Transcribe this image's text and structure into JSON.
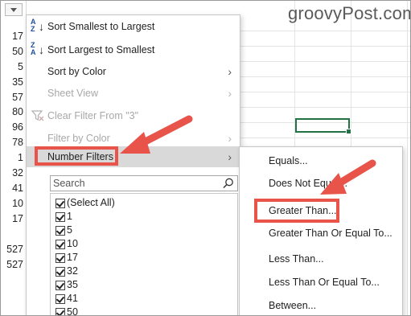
{
  "watermark": "groovyPost.com",
  "row_values": [
    "17",
    "50",
    "5",
    "35",
    "57",
    "80",
    "96",
    "78",
    "1",
    "32",
    "41",
    "10",
    "17",
    "527",
    "527"
  ],
  "menu": {
    "sort_asc": "Sort Smallest to Largest",
    "sort_desc": "Sort Largest to Smallest",
    "sort_by_color": "Sort by Color",
    "sheet_view": "Sheet View",
    "clear_filter": "Clear Filter From \"3\"",
    "filter_by_color": "Filter by Color",
    "number_filters": "Number Filters",
    "search_placeholder": "Search"
  },
  "filter_list": [
    "(Select All)",
    "1",
    "5",
    "10",
    "17",
    "32",
    "35",
    "41",
    "50"
  ],
  "submenu": {
    "equals": "Equals...",
    "does_not_equal": "Does Not Equal...",
    "greater_than": "Greater Than...",
    "greater_equal": "Greater Than Or Equal To...",
    "less_than": "Less Than...",
    "less_equal": "Less Than Or Equal To...",
    "between": "Between..."
  },
  "colors": {
    "highlight_red": "#e8544a",
    "active_cell_green": "#217346",
    "sort_icon_blue": "#1f4e9a"
  },
  "icons": {
    "sort_asc": "sort-ascending-icon",
    "sort_desc": "sort-descending-icon",
    "clear_filter": "clear-filter-icon",
    "search": "search-icon"
  }
}
